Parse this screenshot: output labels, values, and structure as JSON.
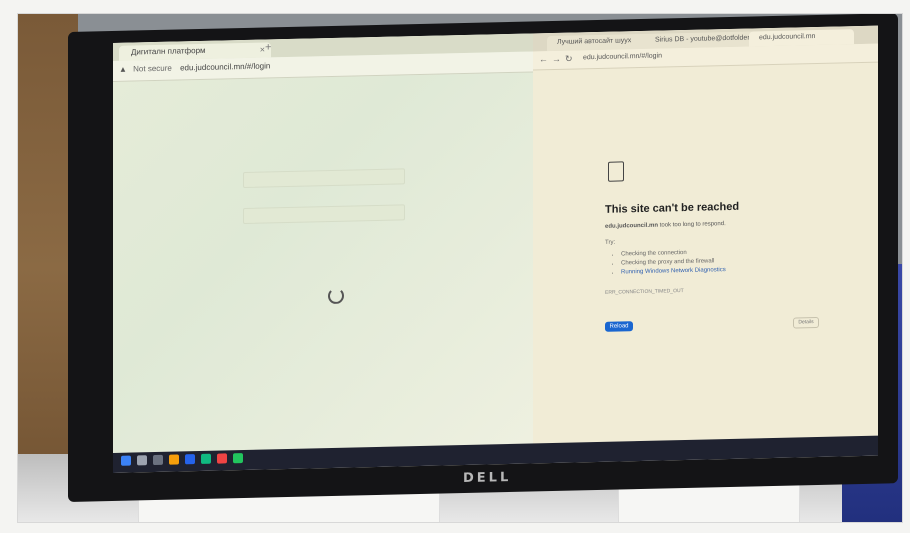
{
  "left_window": {
    "tab_title": "Дигиталн платформ",
    "tab_close": "×",
    "new_tab": "+",
    "warning_icon": "warning-triangle-icon",
    "not_secure": "Not secure",
    "url": "edu.judcouncil.mn/#/login"
  },
  "right_window": {
    "tabs": [
      "Лучший автосайт шуух",
      "Sirius DB - youtube@dotfolder",
      "edu.judcouncil.mn"
    ],
    "url": "edu.judcouncil.mn/#/login",
    "error_title": "This site can't be reached",
    "error_sub_host": "edu.judcouncil.mn",
    "error_sub_text": "took too long to respond.",
    "try_label": "Try:",
    "suggestions": [
      "Checking the connection",
      "Checking the proxy and the firewall",
      "Running Windows Network Diagnostics"
    ],
    "error_code": "ERR_CONNECTION_TIMED_OUT",
    "reload_label": "Reload",
    "details_label": "Details"
  },
  "monitor": {
    "brand": "DELL"
  },
  "colors": {
    "reload_blue": "#1a66d0",
    "taskbar": "#1f2230",
    "bezel": "#141416"
  }
}
